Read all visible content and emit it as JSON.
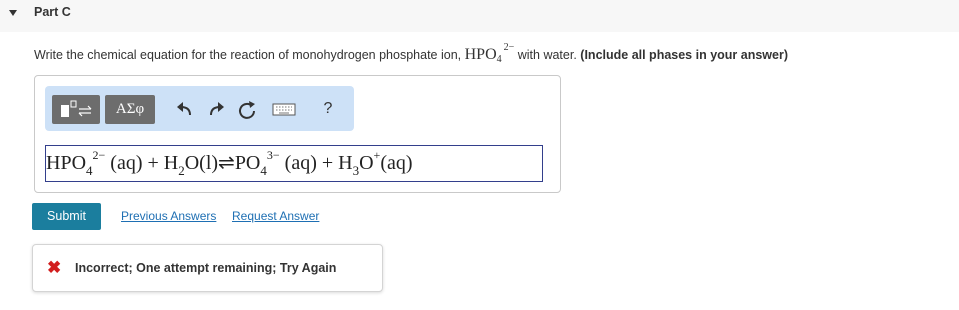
{
  "part": {
    "title": "Part C"
  },
  "question": {
    "prefix": "Write the chemical equation for the reaction of monohydrogen phosphate ion,",
    "formula": "HPO",
    "formula_sub": "4",
    "formula_sup": "2−",
    "suffix": "with water.",
    "bold_note": "(Include all phases in your answer)"
  },
  "toolbar": {
    "greek_label": "ΑΣφ",
    "icons": [
      "templates-icon",
      "greek-letters-icon",
      "undo-icon",
      "redo-icon",
      "reset-icon",
      "keyboard-icon",
      "help-icon"
    ],
    "help_label": "?"
  },
  "answer": {
    "tokens": [
      "HPO",
      "4",
      "2−",
      "(aq) + H",
      "2",
      "O(l)",
      "⇌",
      "PO",
      "4",
      "3−",
      "(aq) + H",
      "3",
      "O",
      "+",
      "(aq)"
    ]
  },
  "actions": {
    "submit_label": "Submit",
    "previous_answers": "Previous Answers",
    "request_answer": "Request Answer"
  },
  "feedback": {
    "status": "incorrect",
    "text": "Incorrect; One attempt remaining; Try Again",
    "color": "#d21e1e"
  },
  "colors": {
    "submit_bg": "#1b7e9e",
    "toolbar_bg": "#cde1f7",
    "link": "#1e6fb3"
  }
}
